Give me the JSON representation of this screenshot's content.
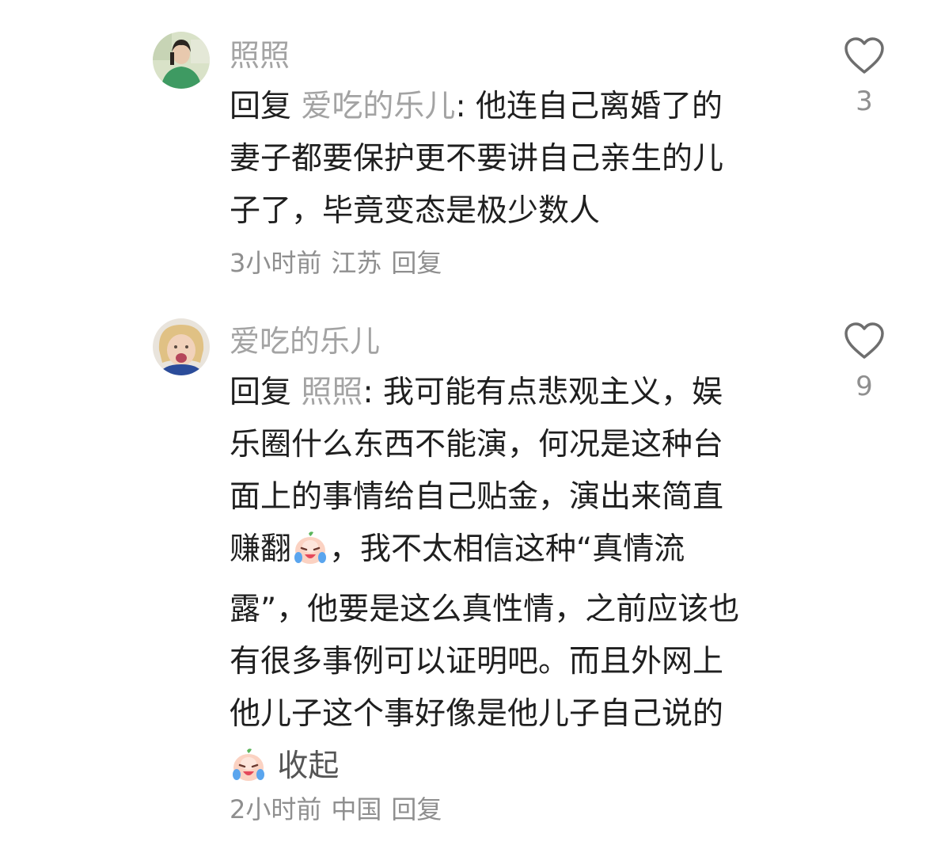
{
  "comments": [
    {
      "username": "照照",
      "reply_prefix": "回复",
      "reply_to": "爱吃的乐儿",
      "lines": [
        "他连自己离婚了的",
        "妻子都要保护更不要讲自己亲生的儿",
        "子了，毕竟变态是极少数人"
      ],
      "time": "3小时前",
      "location": "江苏",
      "reply_label": "回复",
      "likes": "3"
    },
    {
      "username": "爱吃的乐儿",
      "reply_prefix": "回复",
      "reply_to": "照照",
      "lines": [
        "我可能有点悲观主义，娱",
        "乐圈什么东西不能演，何况是这种台",
        "面上的事情给自己贴金，演出来简直",
        "赚翻",
        "，我不太相信这种“真情流",
        "露”，他要是这么真性情，之前应该也",
        "有很多事例可以证明吧。而且外网上",
        "他儿子这个事好像是他儿子自己说的"
      ],
      "emoji": "crying-laughing-peach-emoji",
      "collapse_label": "收起",
      "time": "2小时前",
      "location": "中国",
      "reply_label": "回复",
      "likes": "9"
    }
  ],
  "colors": {
    "username": "#a3a3a3",
    "text": "#1f1f1f",
    "meta": "#8f8f8f"
  }
}
